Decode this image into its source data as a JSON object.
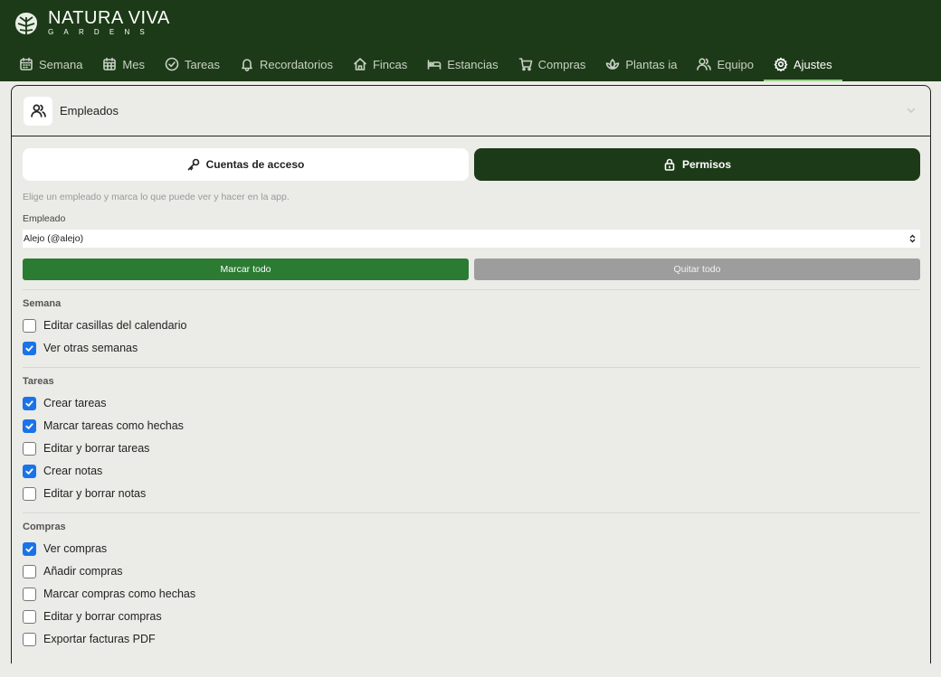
{
  "brand": {
    "title": "NATURA VIVA",
    "subtitle": "GARDENS"
  },
  "nav": [
    {
      "label": "Semana",
      "icon": "calendar-week-icon"
    },
    {
      "label": "Mes",
      "icon": "calendar-month-icon"
    },
    {
      "label": "Tareas",
      "icon": "check-circle-icon"
    },
    {
      "label": "Recordatorios",
      "icon": "bell-icon"
    },
    {
      "label": "Fincas",
      "icon": "home-icon"
    },
    {
      "label": "Estancias",
      "icon": "bed-icon"
    },
    {
      "label": "Compras",
      "icon": "cart-icon"
    },
    {
      "label": "Plantas ia",
      "icon": "plant-icon"
    },
    {
      "label": "Equipo",
      "icon": "users-icon"
    },
    {
      "label": "Ajustes",
      "icon": "gear-icon",
      "active": true
    }
  ],
  "section": {
    "title": "Empleados"
  },
  "tabs": {
    "accounts": "Cuentas de acceso",
    "permissions": "Permisos"
  },
  "hint": "Elige un empleado y marca lo que puede ver y hacer en la app.",
  "employee": {
    "label": "Empleado",
    "selected": "Alejo (@alejo)"
  },
  "actions": {
    "mark_all": "Marcar todo",
    "clear_all": "Quitar todo"
  },
  "groups": [
    {
      "title": "Semana",
      "items": [
        {
          "label": "Editar casillas del calendario",
          "checked": false
        },
        {
          "label": "Ver otras semanas",
          "checked": true
        }
      ]
    },
    {
      "title": "Tareas",
      "items": [
        {
          "label": "Crear tareas",
          "checked": true
        },
        {
          "label": "Marcar tareas como hechas",
          "checked": true
        },
        {
          "label": "Editar y borrar tareas",
          "checked": false
        },
        {
          "label": "Crear notas",
          "checked": true
        },
        {
          "label": "Editar y borrar notas",
          "checked": false
        }
      ]
    },
    {
      "title": "Compras",
      "items": [
        {
          "label": "Ver compras",
          "checked": true
        },
        {
          "label": "Añadir compras",
          "checked": false
        },
        {
          "label": "Marcar compras como hechas",
          "checked": false
        },
        {
          "label": "Editar y borrar compras",
          "checked": false
        },
        {
          "label": "Exportar facturas PDF",
          "checked": false
        }
      ]
    }
  ],
  "colors": {
    "header": "#1d3a18",
    "accent_green": "#2c7b32",
    "checkbox_blue": "#1a73e8",
    "active_underline": "#9bd18c"
  }
}
